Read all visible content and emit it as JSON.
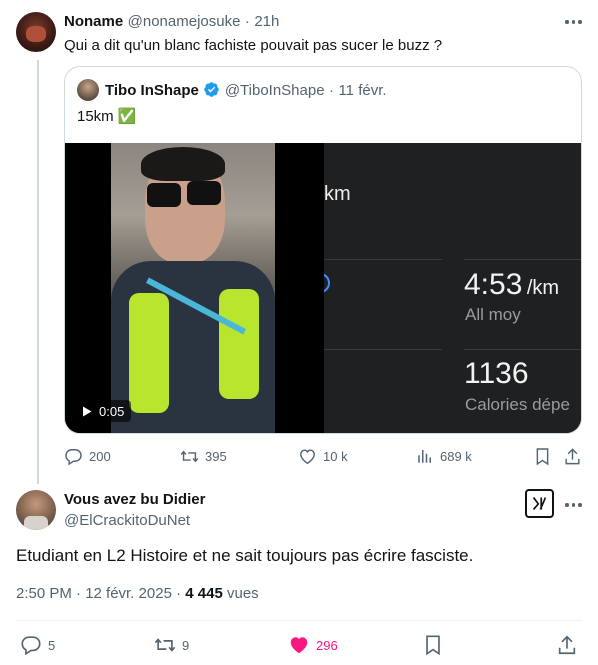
{
  "reply": {
    "author_name": "Noname",
    "handle": "@nonamejosuke",
    "separator": "·",
    "time": "21h",
    "text": "Qui a dit qu'un blanc fachiste pouvait pas sucer le buzz ?",
    "quoted": {
      "author_name": "Tibo InShape",
      "handle": "@TiboInShape",
      "separator": "·",
      "date": "11 févr.",
      "text": "15km ✅",
      "video": {
        "duration": "0:05",
        "screen_left_partial_text": "km",
        "pace_value": "4:53",
        "pace_unit": "/km",
        "pace_label": "All moy",
        "calories_value": "1136",
        "calories_label": "Calories dépe"
      }
    },
    "actions": {
      "replies": "200",
      "reposts": "395",
      "likes": "10 k",
      "views": "689 k"
    }
  },
  "main": {
    "author_name": "Vous avez bu Didier",
    "handle": "@ElCrackitoDuNet",
    "text": "Etudiant en L2 Histoire et ne sait toujours pas écrire fasciste.",
    "timestamp": "2:50 PM · 12 févr. 2025 ·",
    "views_count": "4 445",
    "views_label": "vues",
    "actions": {
      "replies": "5",
      "reposts": "9",
      "likes": "296"
    }
  },
  "colors": {
    "like_active": "#f91880",
    "verified": "#1d9bf0",
    "muted": "#536471",
    "border": "#cfd9de"
  }
}
